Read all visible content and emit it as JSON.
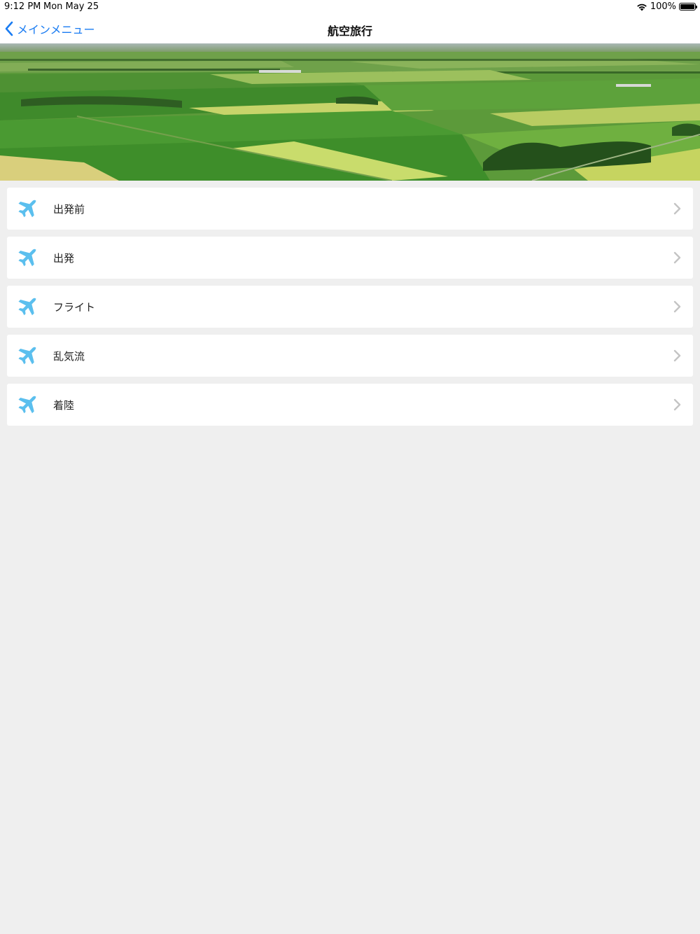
{
  "status_bar": {
    "time": "9:12 PM",
    "date": "Mon May 25",
    "battery": "100%",
    "wifi_icon": "wifi-icon",
    "battery_icon": "battery-icon"
  },
  "nav": {
    "back_label": "メインメニュー",
    "back_icon": "chevron-left-icon",
    "title": "航空旅行"
  },
  "hero": {
    "image": "farmland-aerial-photo"
  },
  "colors": {
    "accent": "#1a7cf2",
    "icon": "#5bbfee",
    "chevron": "#c4c4c4",
    "background": "#efefef"
  },
  "menu": {
    "items": [
      {
        "label": "出発前",
        "icon": "airplane-icon"
      },
      {
        "label": "出発",
        "icon": "airplane-icon"
      },
      {
        "label": "フライト",
        "icon": "airplane-icon"
      },
      {
        "label": "乱気流",
        "icon": "airplane-icon"
      },
      {
        "label": "着陸",
        "icon": "airplane-icon"
      }
    ]
  }
}
